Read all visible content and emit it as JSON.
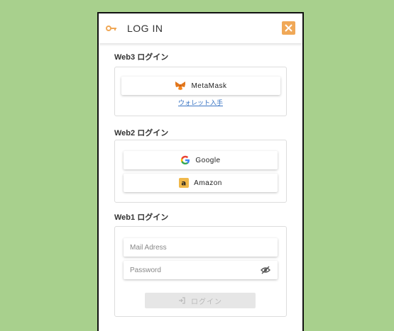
{
  "header": {
    "title": "LOG IN",
    "key_icon": "key-icon",
    "close_icon": "close-icon",
    "accent": "#f0a857"
  },
  "web3": {
    "label": "Web3 ログイン",
    "metamask_label": "MetaMask",
    "wallet_link": "ウォレット入手"
  },
  "web2": {
    "label": "Web2 ログイン",
    "google_label": "Google",
    "amazon_label": "Amazon"
  },
  "web1": {
    "label": "Web1 ログイン",
    "mail_placeholder": "Mail Adress",
    "password_placeholder": "Password",
    "login_label": "ログイン"
  }
}
